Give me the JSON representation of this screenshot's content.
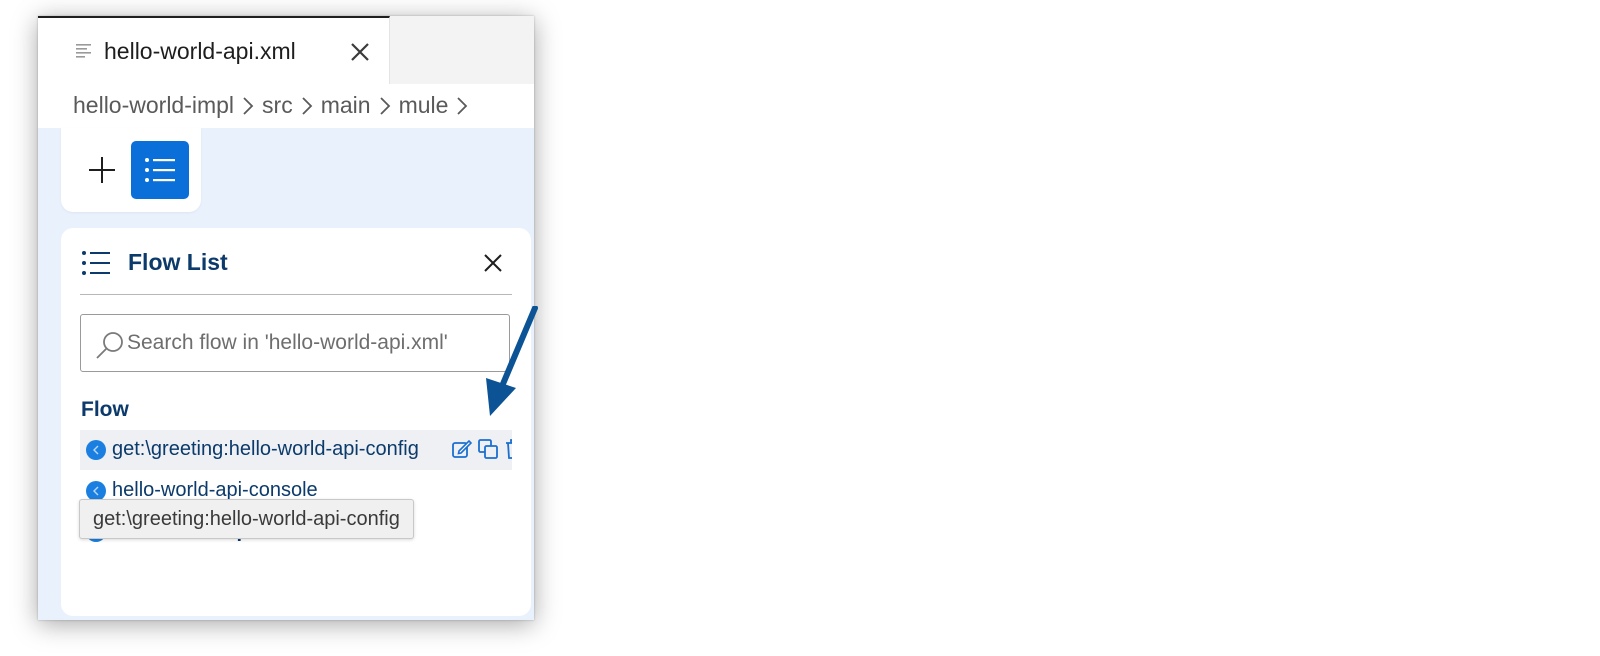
{
  "editor": {
    "tab": {
      "title": "hello-world-api.xml",
      "file_icon": "file-lines-icon",
      "close_icon": "close-icon"
    },
    "breadcrumb": [
      "hello-world-impl",
      "src",
      "main",
      "mule"
    ]
  },
  "toolbar": {
    "add_icon": "plus-icon",
    "list_icon": "list-icon"
  },
  "flow_panel": {
    "title": "Flow List",
    "search_placeholder": "Search flow in 'hello-world-api.xml'",
    "section_label": "Flow",
    "items": [
      {
        "label": "get:\\greeting:hello-world-api-config",
        "selected": true
      },
      {
        "label": "hello-world-api-console",
        "selected": false
      },
      {
        "label": "hello-world-api-main",
        "selected": false
      }
    ],
    "actions": [
      "edit-icon",
      "duplicate-icon",
      "delete-icon"
    ]
  },
  "tooltip": {
    "text": "get:\\greeting:hello-world-api-config"
  },
  "colors": {
    "accent": "#0a6fd8",
    "title_text": "#0b3a6b",
    "canvas_bg": "#e9f1fd",
    "annotation_arrow": "#0b5394"
  }
}
